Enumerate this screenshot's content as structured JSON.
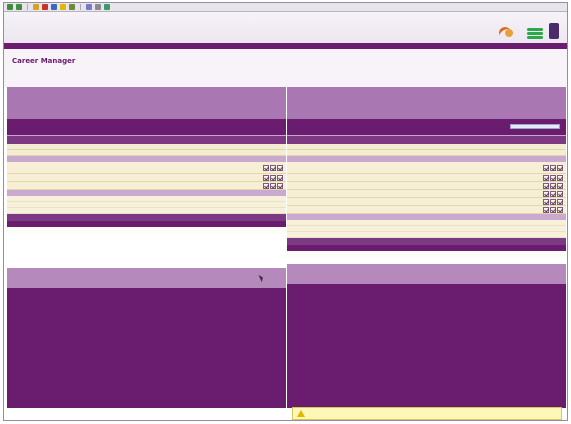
{
  "app": {
    "title": "Career Manager"
  },
  "colors": {
    "accent": "#6a1b6f",
    "light": "#b689bc",
    "cream": "#f6efd6",
    "warn": "#fff7b8"
  },
  "toolbar": {
    "buttons": [
      "back-icon",
      "forward-icon",
      "refresh-icon",
      "home-icon",
      "search-icon",
      "favorites-icon",
      "history-icon",
      "mail-icon",
      "print-icon",
      "edit-icon"
    ]
  },
  "left": {
    "rows": [
      {
        "tall": true
      },
      {
        "tall": false
      },
      {
        "tall": false
      }
    ],
    "blanks": 3
  },
  "right": {
    "rows": [
      {
        "tall": true
      },
      {
        "tall": false
      },
      {
        "tall": false
      },
      {
        "tall": false
      },
      {
        "tall": false
      },
      {
        "tall": false
      }
    ],
    "blanks": 3
  }
}
